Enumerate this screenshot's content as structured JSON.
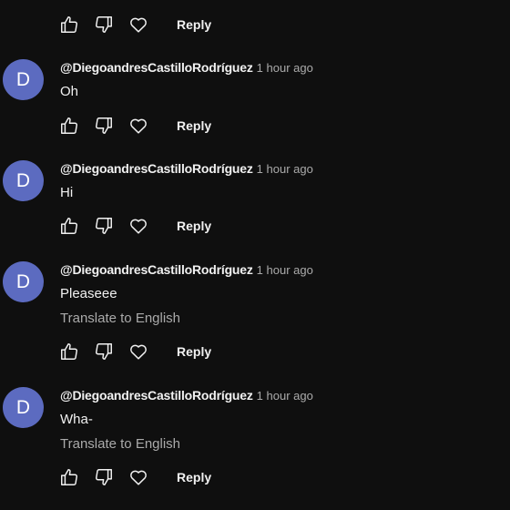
{
  "actions": {
    "reply_label": "Reply",
    "like_icon": "thumbs-up-icon",
    "dislike_icon": "thumbs-down-icon",
    "heart_icon": "heart-icon"
  },
  "comments": [
    {
      "avatar_letter": "D",
      "author": "@DiegoandresCastilloRodríguez",
      "time": "1 hour ago",
      "text": "Oh"
    },
    {
      "avatar_letter": "D",
      "author": "@DiegoandresCastilloRodríguez",
      "time": "1 hour ago",
      "text": "Hi"
    },
    {
      "avatar_letter": "D",
      "author": "@DiegoandresCastilloRodríguez",
      "time": "1 hour ago",
      "text": "Pleaseee",
      "translate_label": "Translate to English"
    },
    {
      "avatar_letter": "D",
      "author": "@DiegoandresCastilloRodríguez",
      "time": "1 hour ago",
      "text": "Wha-",
      "translate_label": "Translate to English"
    }
  ],
  "colors": {
    "background": "#0f0f0f",
    "avatar": "#5c6bc0",
    "text": "#f1f1f1",
    "secondary_text": "#aaaaaa"
  }
}
